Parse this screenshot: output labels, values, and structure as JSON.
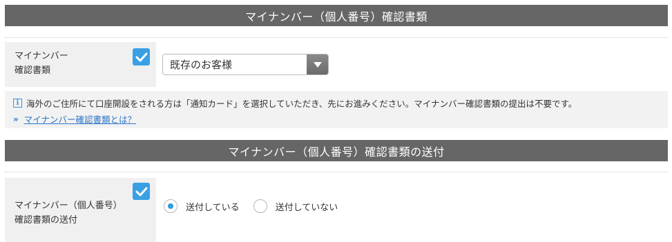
{
  "section1": {
    "title": "マイナンバー（個人番号）確認書類",
    "field": {
      "label_line1": "マイナンバー",
      "label_line2": "確認書類",
      "select_value": "既存のお客様"
    },
    "info": {
      "icon": "info-icon",
      "text": "海外のご住所にて口座開設をされる方は「通知カード」を選択していただき、先にお進みください。マイナンバー確認書類の提出は不要です。",
      "link_text": "マイナンバー確認書類とは？"
    }
  },
  "section2": {
    "title": "マイナンバー（個人番号）確認書類の送付",
    "field": {
      "label_line1": "マイナンバー（個人番号）",
      "label_line2": "確認書類の送付",
      "options": [
        {
          "label": "送付している",
          "selected": true
        },
        {
          "label": "送付していない",
          "selected": false
        }
      ]
    }
  },
  "colors": {
    "header_bg": "#666666",
    "check_accent": "#3aa0e4",
    "link": "#2b75c9",
    "label_bg": "#f0f0f0"
  }
}
